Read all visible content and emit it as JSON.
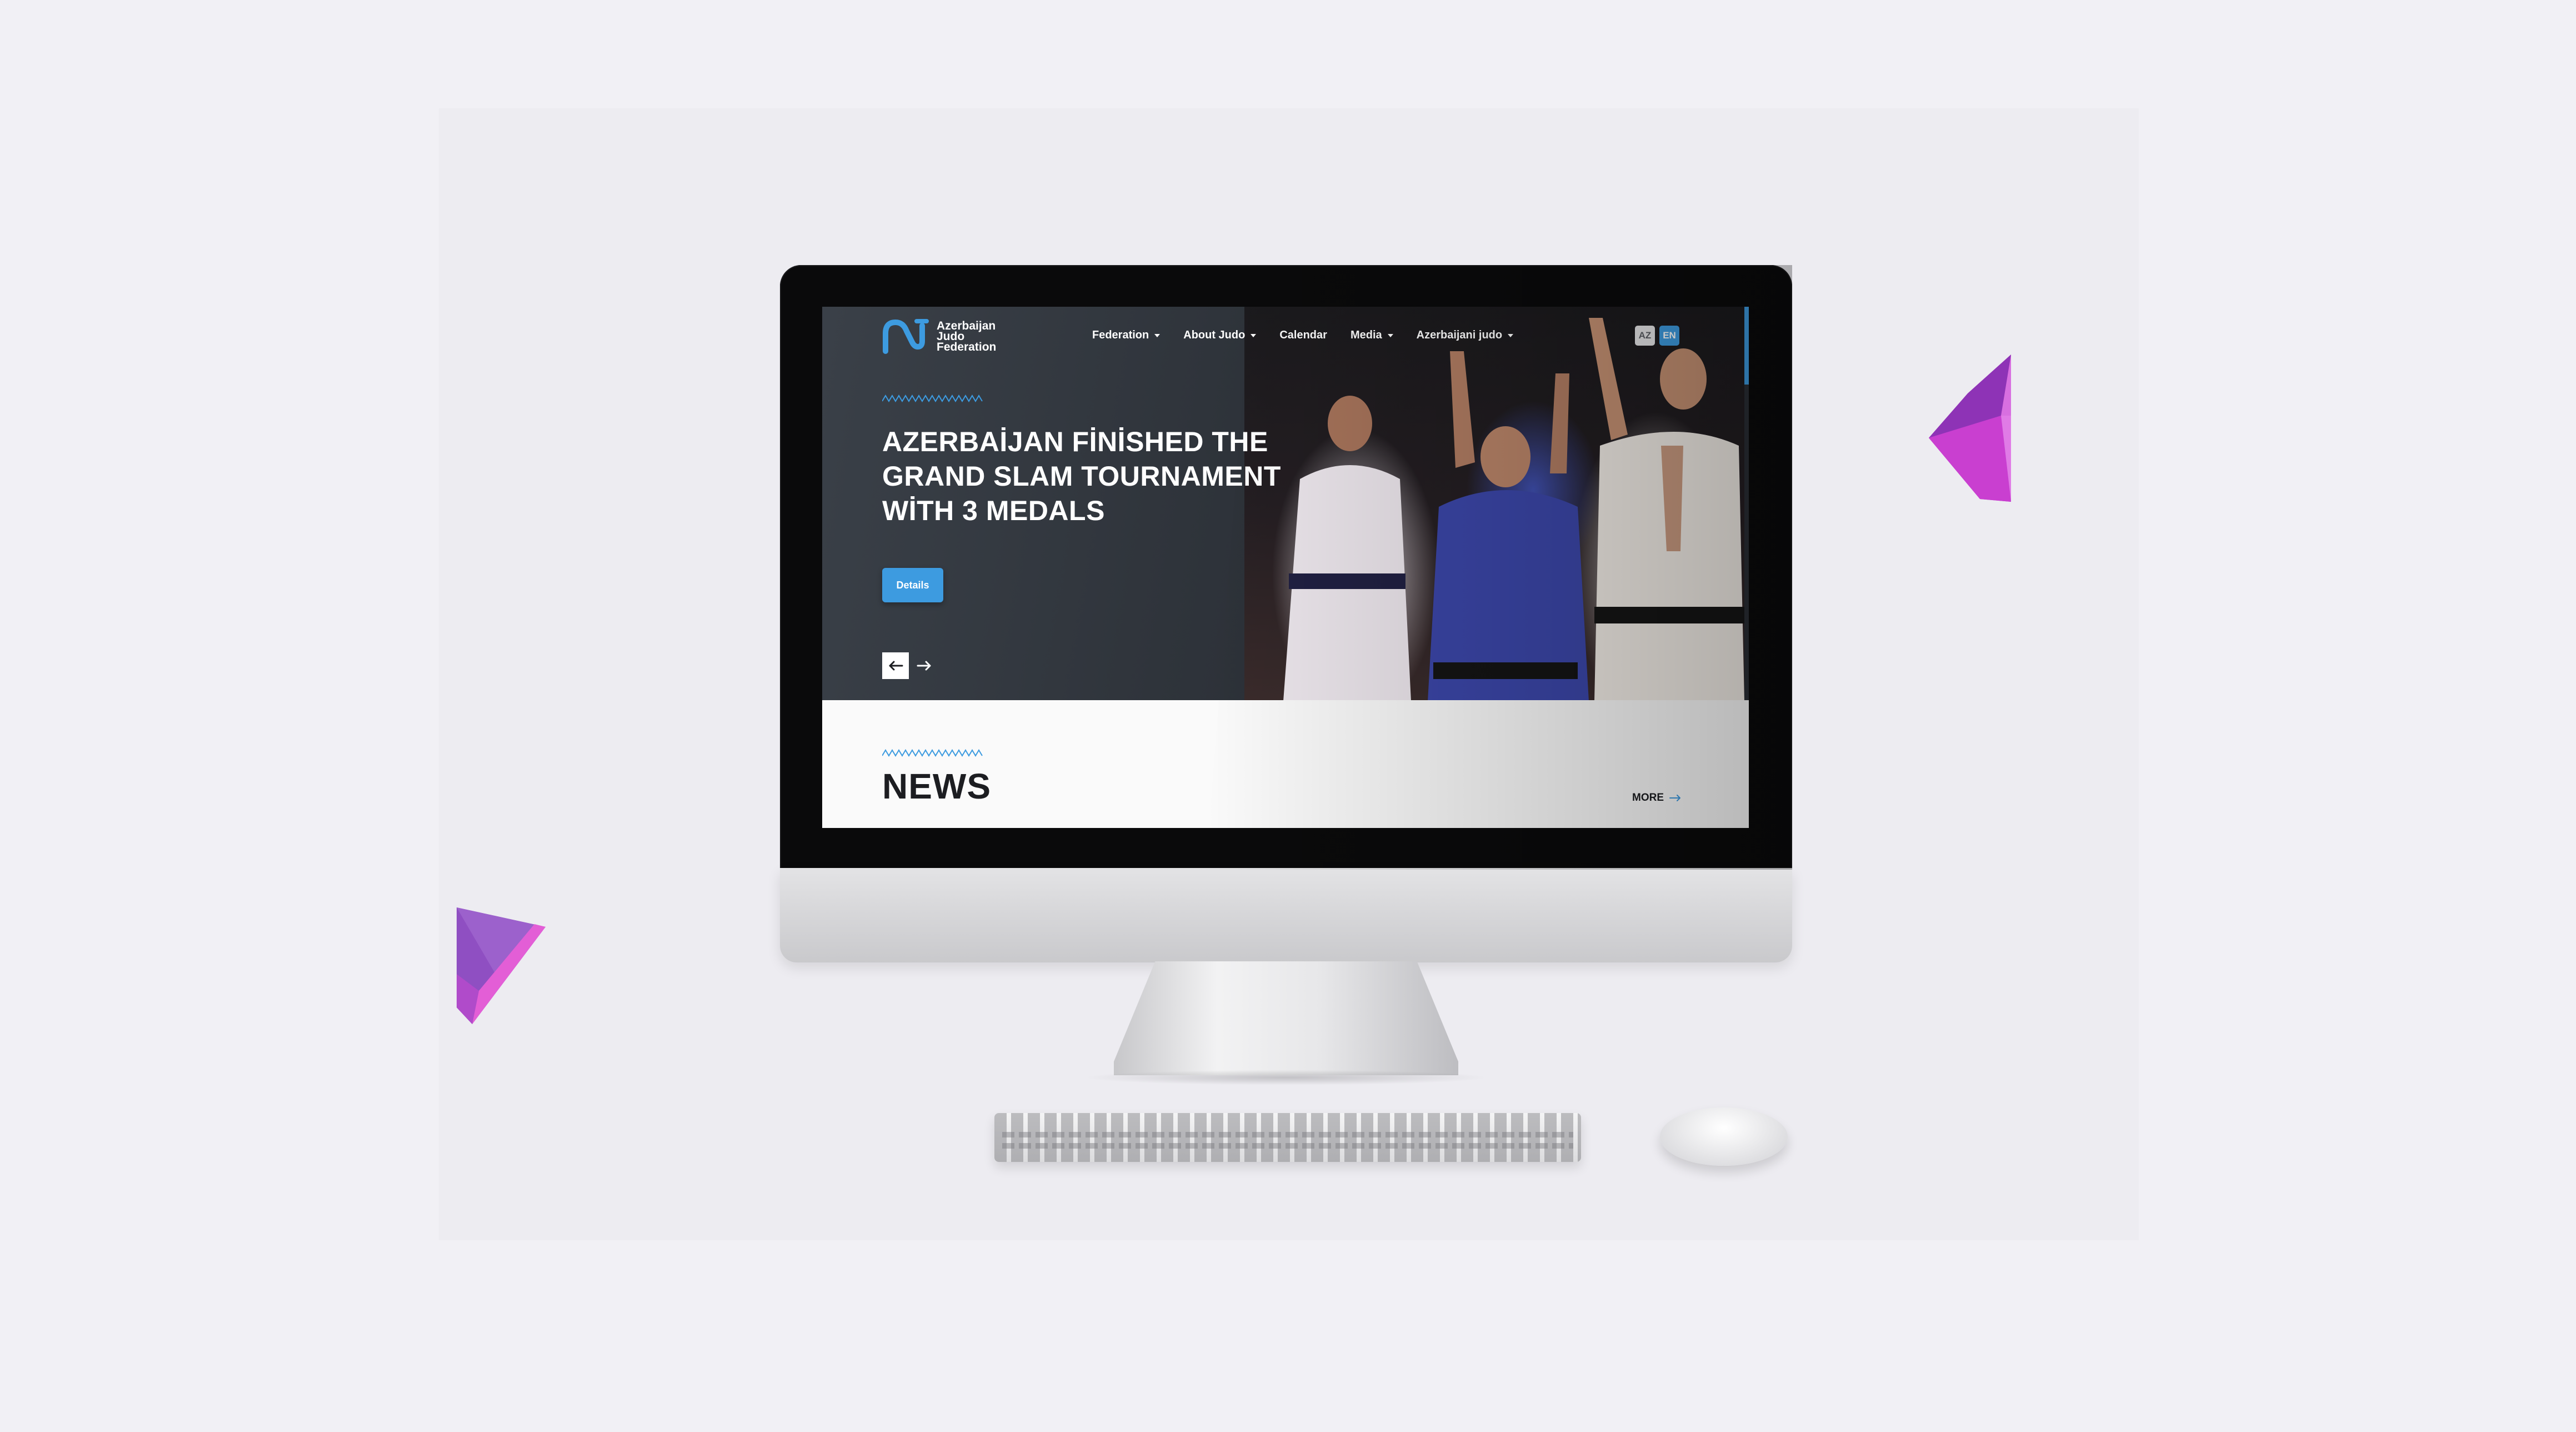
{
  "site": {
    "logo_text": "Azerbaijan Judo Federation",
    "logo_icon": "ajf-logo-icon"
  },
  "nav": {
    "items": [
      {
        "label": "Federation",
        "dropdown": true
      },
      {
        "label": "About Judo",
        "dropdown": true
      },
      {
        "label": "Calendar",
        "dropdown": false
      },
      {
        "label": "Media",
        "dropdown": true
      },
      {
        "label": "Azerbaijani judo",
        "dropdown": true
      }
    ],
    "languages": [
      {
        "code": "AZ",
        "active": false
      },
      {
        "code": "EN",
        "active": true
      }
    ]
  },
  "hero": {
    "title": "AZERBAİJAN FİNİSHED THE GRAND SLAM TOURNAMENT WİTH 3 MEDALS",
    "details_label": "Details",
    "prev_icon": "arrow-left-icon",
    "next_icon": "arrow-right-icon"
  },
  "news": {
    "title": "NEWS",
    "more_label": "MORE"
  },
  "colors": {
    "accent": "#3d9be0",
    "hero_bg": "#2f343b",
    "gem_purple": "#b43fc6",
    "gem_pink": "#e85bd5"
  }
}
